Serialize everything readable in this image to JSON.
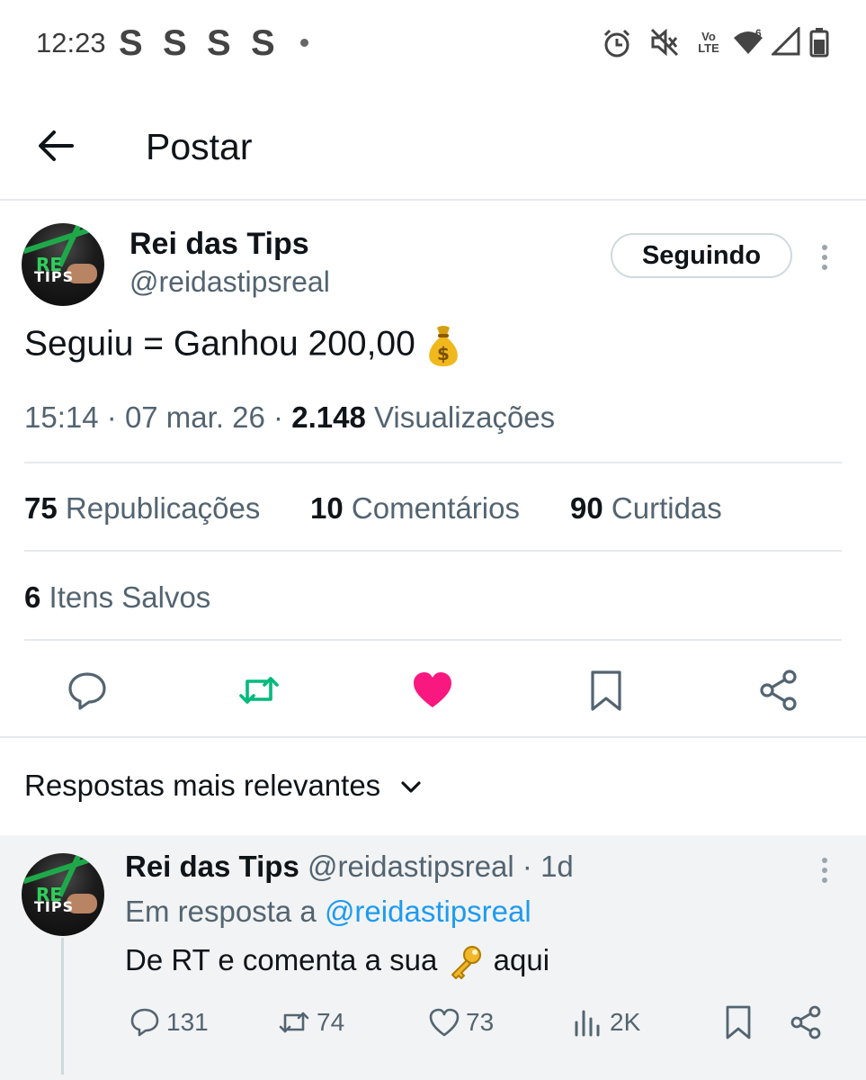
{
  "status_bar": {
    "time": "12:23",
    "notif_letters": [
      "S",
      "S",
      "S",
      "S"
    ],
    "icons": [
      "alarm-icon",
      "mute-icon",
      "volte-icon",
      "wifi-icon",
      "signal-icon",
      "battery-icon"
    ],
    "volte_top": "Vo",
    "volte_bottom": "LTE",
    "wifi_badge": "6"
  },
  "header": {
    "title": "Postar"
  },
  "post": {
    "author_name": "Rei das Tips",
    "author_handle": "@reidastipsreal",
    "follow_label": "Seguindo",
    "text": "Seguiu = Ganhou 200,00",
    "time": "15:14",
    "date": "07 mar. 26",
    "views_count": "2.148",
    "views_label": "Visualizações",
    "separator": "·",
    "stats": {
      "reposts_count": "75",
      "reposts_label": "Republicações",
      "comments_count": "10",
      "comments_label": "Comentários",
      "likes_count": "90",
      "likes_label": "Curtidas",
      "saved_count": "6",
      "saved_label": "Itens Salvos"
    },
    "liked": true
  },
  "replies": {
    "sort_label": "Respostas mais relevantes",
    "items": [
      {
        "author_name": "Rei das Tips",
        "author_handle": "@reidastipsreal",
        "age": "1d",
        "separator": "·",
        "reply_to_prefix": "Em resposta a",
        "reply_to_handle": "@reidastipsreal",
        "text_before": "De RT e comenta a sua",
        "text_after": "aqui",
        "replies_count": "131",
        "reposts_count": "74",
        "likes_count": "73",
        "views_count": "2K"
      }
    ]
  },
  "colors": {
    "accent": "#1d9bf0",
    "repost_green": "#00ba7c",
    "like_pink": "#f91880",
    "secondary_text": "#536471",
    "primary_text": "#0f1419",
    "reply_background": "#f2f3f4"
  }
}
